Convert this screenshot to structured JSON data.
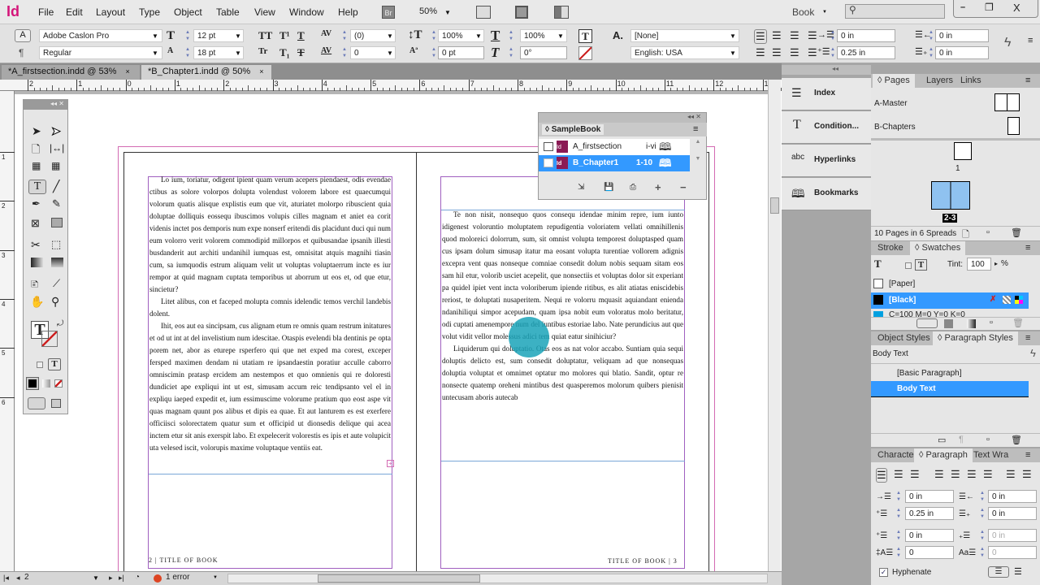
{
  "menu": {
    "logo": "Id",
    "items": [
      "File",
      "Edit",
      "Layout",
      "Type",
      "Object",
      "Table",
      "View",
      "Window",
      "Help"
    ],
    "bridge": "Br",
    "zoom": "50%",
    "workspace": "Book",
    "search_placeholder": ""
  },
  "control": {
    "font_family": "Adobe Caslon Pro",
    "font_style": "Regular",
    "font_size": "12 pt",
    "leading": "18 pt",
    "kerning": "(0)",
    "tracking": "0",
    "vertical_scale": "100%",
    "baseline_shift": "0 pt",
    "horizontal_scale": "100%",
    "skew": "0°",
    "char_style": "[None]",
    "language": "English: USA",
    "left_indent": "0 in",
    "first_line_indent": "0.25 in",
    "right_indent": "0 in",
    "last_line_indent": "0 in"
  },
  "doc_tabs": [
    {
      "label": "*A_firstsection.indd @ 53%"
    },
    {
      "label": "*B_Chapter1.indd @ 50%"
    }
  ],
  "ruler": {
    "labels": [
      "2",
      "1",
      "0",
      "1",
      "2",
      "3",
      "4",
      "5",
      "6",
      "7",
      "8",
      "9",
      "10",
      "11",
      "12",
      "13"
    ],
    "vlabels": [
      "1",
      "2",
      "3",
      "4",
      "5",
      "6"
    ]
  },
  "document": {
    "left_page": {
      "paragraphs": [
        "Lo ium, toriatur, odigent ipient quam verum acepers piendaest, odis evendae ctibus as solore volorpos dolupta volendust volorem labore est quaecumqui volorum quatis alisque explistis eum que vit, aturiatet molorpo ribuscient quia doluptae dolliquis eossequ ibuscimos volupis cilles magnam et aniet ea corit videnis inctet pos demporis num expe nonserf eritendi dis placidunt duci qui num eum volorro verit volorem commodipid millorpos et quibusandae ipsanih illesti busdanderit aut architi undanihil iumquas est, omnisitat atquis magnihi tiasin cum, sa iumquodis estrum aliquam velit ut voluptas voluptaerrum incte es iur rempor at quid magnam cuptata temporibus ut aborrum ut eos et, od que etur, sincietur?",
        "Litet alibus, con et faceped molupta comnis idelendic temos verchil landebis dolent.",
        "Ihit, eos aut ea sincipsam, cus alignam etum re omnis quam restrum initatures et od ut int at del invelistium num idescitae. Otaspis evelendi bla dentinis pe opta porem net, abor as eturepe rsperfero qui que net exped ma corest, exceper fersped maximen dendam ni utatiam re ipsandaestin poratiur acculle caborro omniscimin pratasp ercidem am nestempos et quo omnienis qui re doloresti dundiciet ape expliqui int ut est, simusam accum reic tendipsanto vel el in expliqu iaeped expedit et, ium essimuscime volorume pratium quo eost aspe vit quas magnam quunt pos alibus et dipis ea quae. Et aut lanturem es est exerfere officiisci solorectatem quatur sum et officipid ut dionsedis delique qui acea inctem etur sit anis exerspit labo. Et expelecerit volorestis es ipis et aute volupicit uta velesed iscit, volorupis maxime voluptaque ventiis eat."
      ],
      "footer": "2 | TITLE OF BOOK"
    },
    "right_page": {
      "paragraphs": [
        "Te non nisit, nonsequo quos consequ idendae minim repre, ium iunto idigenest voloruntio moluptatem repudigentia voloriatem vellati omnihillenis quod moloreici dolorrum, sum, sit omnist volupta temporest doluptasped quam cus ipsam dolum simusap itatur ma eosant volupta turentiae vollorem adignis excepra vent quas nonseque comniae consedit dolum nobis sequam sitam eos sam hil etur, volorib usciet acepelit, que nonsectiis et voluptas dolor sit experiant pa quidel ipiet vent incta voloriberum ipiende ritibus, es alit atiatas eniscidebis reriost, te doluptati nusaperitem. Nequi re volorru mquasit aquiandant enienda ndanihiliqui simpor acepudam, quam ipsa nobit eum voloratus molo beritatur, odi cuptati amenempore num del iuntibus estoriae labo. Nate perundicius aut que volut vidit vellor molessus adici tem quiat eatur sinihiciur?",
        "Liquiderum qui doluptatio. Otas eos as nat volor accabo. Suntiam quia sequi doluptis delicto est, sum consedit doluptatur, veliquam ad que nonsequas doluptia voluptat et omnimet optatur mo molores qui blatio. Sandit, optur re nonsecte quatemp oreheni mintibus dest quasperemos molorum quibers pienisit untecusam aboris autecab"
      ],
      "footer": "TITLE OF BOOK | 3"
    }
  },
  "book_panel": {
    "title": "SampleBook",
    "items": [
      {
        "name": "A_firstsection",
        "pages": "i-vi"
      },
      {
        "name": "B_Chapter1",
        "pages": "1-10"
      }
    ]
  },
  "dock": {
    "items": [
      "Index",
      "Condition...",
      "Hyperlinks",
      "Bookmarks"
    ]
  },
  "pages_panel": {
    "tabs": [
      "Pages",
      "Layers",
      "Links"
    ],
    "masters": [
      "A-Master",
      "B-Chapters"
    ],
    "page_label": "1",
    "spread_label": "2-3",
    "status": "10 Pages in 6 Spreads"
  },
  "swatches": {
    "tabs": [
      "Stroke",
      "Swatches"
    ],
    "tint_label": "Tint:",
    "tint": "100",
    "tint_unit": "%",
    "items": [
      {
        "name": "[Paper]",
        "color": "#ffffff"
      },
      {
        "name": "[Black]",
        "color": "#000000"
      },
      {
        "name": "C=100 M=0 Y=0 K=0",
        "color": "#00a0e0"
      }
    ]
  },
  "para_styles": {
    "tabs": [
      "Object Styles",
      "Paragraph Styles"
    ],
    "current": "Body Text",
    "items": [
      "[Basic Paragraph]",
      "Body Text"
    ]
  },
  "paragraph": {
    "tabs": [
      "Character",
      "Paragraph",
      "Text Wra"
    ],
    "left_indent": "0 in",
    "right_indent": "0 in",
    "first_indent": "0.25 in",
    "last_indent": "0 in",
    "space_before": "0 in",
    "space_after": "0 in",
    "drop_lines": "0",
    "drop_chars": "0",
    "hyphenate": "Hyphenate",
    "hyphenate_checked": true
  },
  "status": {
    "page": "2",
    "errors": "1 error"
  },
  "colors": {
    "selection": "#3399ff",
    "frame": "#a060c0",
    "cursor": "#1aa3b8"
  }
}
